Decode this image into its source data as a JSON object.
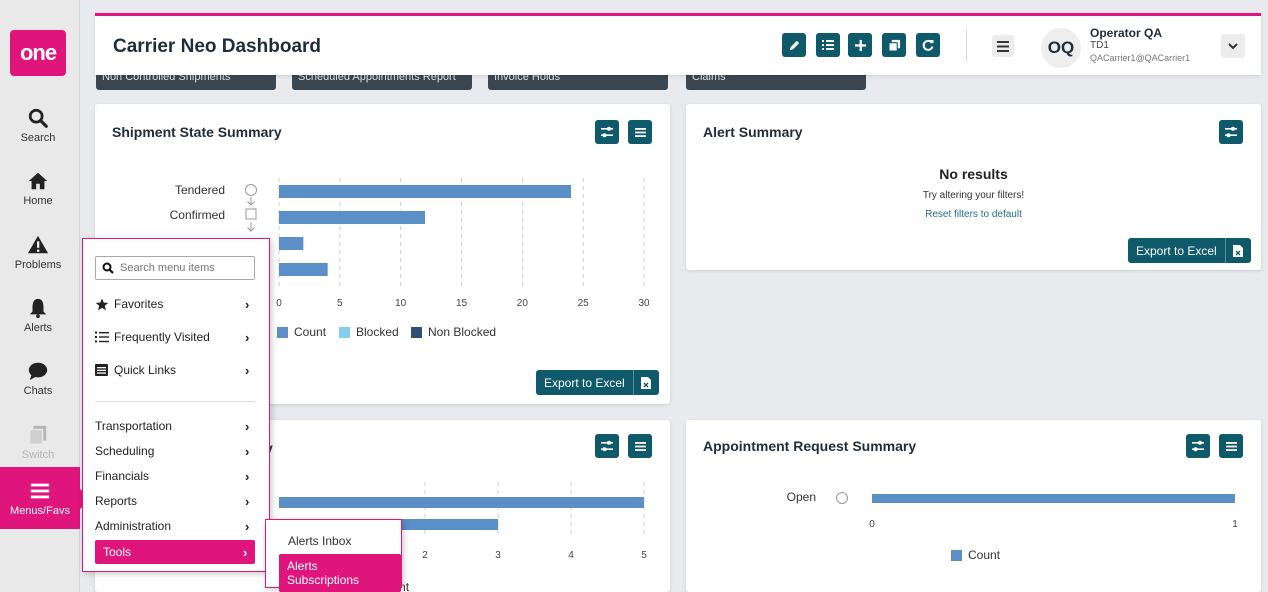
{
  "nav": {
    "logo": "one",
    "items": [
      {
        "label": "Search"
      },
      {
        "label": "Home"
      },
      {
        "label": "Problems"
      },
      {
        "label": "Alerts"
      },
      {
        "label": "Chats"
      },
      {
        "label": "Switch"
      },
      {
        "label": "Menus/Favs"
      }
    ]
  },
  "header": {
    "title": "Carrier Neo Dashboard",
    "user": {
      "initials": "OQ",
      "name": "Operator QA",
      "td": "TD1",
      "email": "QACarrier1@QACarrier1"
    }
  },
  "tiles": [
    "Non Controlled Shipments",
    "Scheduled Appointments Report",
    "Invoice Holds",
    "Claims"
  ],
  "shipment": {
    "title": "Shipment State Summary",
    "export_label": "Export to Excel"
  },
  "alert_summary": {
    "title": "Alert Summary",
    "no_results": "No results",
    "hint": "Try altering your filters!",
    "reset": "Reset filters to default",
    "export_label": "Export to Excel"
  },
  "appointment": {
    "title": "Appointment Request Summary"
  },
  "second_left_card": {
    "title_fragment": "y"
  },
  "chart_data": [
    {
      "type": "bar",
      "categories": [
        "Tendered",
        "Confirmed",
        "",
        ""
      ],
      "series": [
        {
          "name": "Count",
          "values": [
            24,
            12,
            2,
            4
          ]
        }
      ],
      "xticks": [
        "0",
        "5",
        "10",
        "15",
        "20",
        "25",
        "30"
      ],
      "xlim": [
        0,
        30
      ],
      "legend": [
        "Count",
        "Blocked",
        "Non Blocked"
      ],
      "legend_placement": "bottom",
      "colors": {
        "count": "#5b8fc7",
        "blocked": "#86cdf0",
        "non_blocked": "#2c5078"
      }
    },
    {
      "type": "bar",
      "categories": [
        "",
        ""
      ],
      "series": [
        {
          "name": "Count",
          "values": [
            5,
            3
          ]
        }
      ],
      "xticks": [
        "2",
        "3",
        "4",
        "5"
      ],
      "xlim": [
        0,
        5
      ],
      "legend": [
        "Count"
      ],
      "legend_placement": "bottom"
    },
    {
      "type": "bar",
      "categories": [
        "Open"
      ],
      "series": [
        {
          "name": "Count",
          "values": [
            1
          ]
        }
      ],
      "xticks": [
        "0",
        "1"
      ],
      "xlim": [
        0,
        1
      ],
      "legend": [
        "Count"
      ],
      "legend_placement": "bottom"
    }
  ],
  "menu": {
    "search_placeholder": "Search menu items",
    "top": [
      {
        "label": "Favorites",
        "icon": "star-icon"
      },
      {
        "label": "Frequently Visited",
        "icon": "list-icon"
      },
      {
        "label": "Quick Links",
        "icon": "quick-links-icon"
      }
    ],
    "sections": [
      {
        "label": "Transportation"
      },
      {
        "label": "Scheduling"
      },
      {
        "label": "Financials"
      },
      {
        "label": "Reports"
      },
      {
        "label": "Administration"
      },
      {
        "label": "Tools"
      }
    ],
    "chevron": "›"
  },
  "submenu": {
    "items": [
      {
        "label": "Alerts Inbox"
      },
      {
        "label": "Alerts Subscriptions"
      }
    ]
  },
  "colors": {
    "accent": "#e0157c",
    "teal": "#0e5a6a"
  }
}
